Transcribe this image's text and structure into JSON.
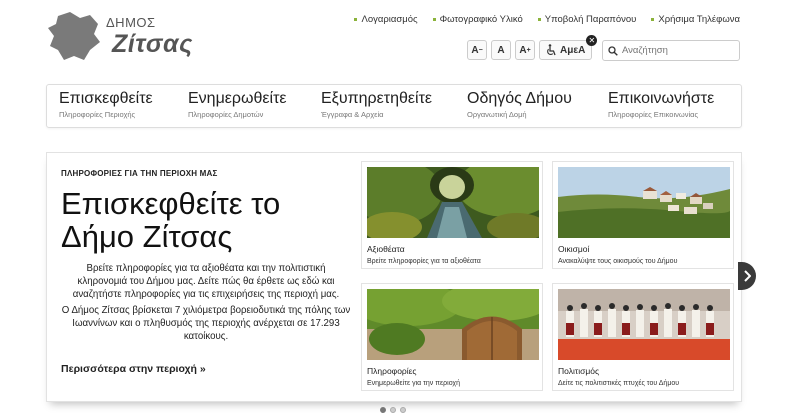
{
  "logo": {
    "top": "ΔΗΜΟΣ",
    "name": "Ζίτσας"
  },
  "toplinks": [
    {
      "label": "Λογαριασμός"
    },
    {
      "label": "Φωτογραφικό Υλικό"
    },
    {
      "label": "Υποβολή Παραπόνου"
    },
    {
      "label": "Χρήσιμα Τηλέφωνα"
    }
  ],
  "toolbar": {
    "font_small": "A",
    "font_normal": "A",
    "font_large": "A",
    "amea_label": "ΑμεΑ",
    "close_glyph": "✕"
  },
  "search": {
    "placeholder": "Αναζήτηση"
  },
  "nav": [
    {
      "title": "Επισκεφθείτε",
      "subtitle": "Πληροφορίες Περιοχής"
    },
    {
      "title": "Ενημερωθείτε",
      "subtitle": "Πληροφορίες Δημοτών"
    },
    {
      "title": "Εξυπηρετηθείτε",
      "subtitle": "Έγγραφα & Αρχεία"
    },
    {
      "title": "Οδηγός Δήμου",
      "subtitle": "Οργανωτική Δομή"
    },
    {
      "title": "Επικοινωνήστε",
      "subtitle": "Πληροφορίες Επικοινωνίας"
    }
  ],
  "intro": {
    "eyebrow": "ΠΛΗΡΟΦΟΡΙΕΣ ΓΙΑ ΤΗΝ ΠΕΡΙΟΧΗ ΜΑΣ",
    "headline": "Επισκεφθείτε το Δήμο Ζίτσας",
    "para1": "Βρείτε πληροφορίες για τα αξιοθέατα και την πολιτιστική κληρονομιά του Δήμου μας. Δείτε πώς θα έρθετε ως εδώ και αναζητήστε πληροφορίες για τις επιχειρήσεις της περιοχή μας.",
    "para2": "Ο Δήμος Ζίτσας βρίσκεται 7 χιλιόμετρα βορειοδυτικά της πόλης των Ιωαννίνων και ο πληθυσμός της περιοχής ανέρχεται σε 17.293 κατοίκους.",
    "more": "Περισσότερα στην περιοχή »"
  },
  "tiles": [
    {
      "title": "Αξιοθέατα",
      "subtitle": "Βρείτε πληροφορίες για τα αξιοθέατα"
    },
    {
      "title": "Οικισμοί",
      "subtitle": "Ανακαλύψτε τους οικισμούς του Δήμου"
    },
    {
      "title": "Πληροφορίες",
      "subtitle": "Ενημερωθείτε για την περιοχή"
    },
    {
      "title": "Πολιτισμός",
      "subtitle": "Δείτε τις πολιτιστικές πτυχές του Δήμου"
    }
  ],
  "slider": {
    "active_index": 0,
    "count": 3
  },
  "colors": {
    "accent": "#8bb33a",
    "logo_gray": "#7a7a7a",
    "arrow_bg": "#3a3a3a"
  }
}
